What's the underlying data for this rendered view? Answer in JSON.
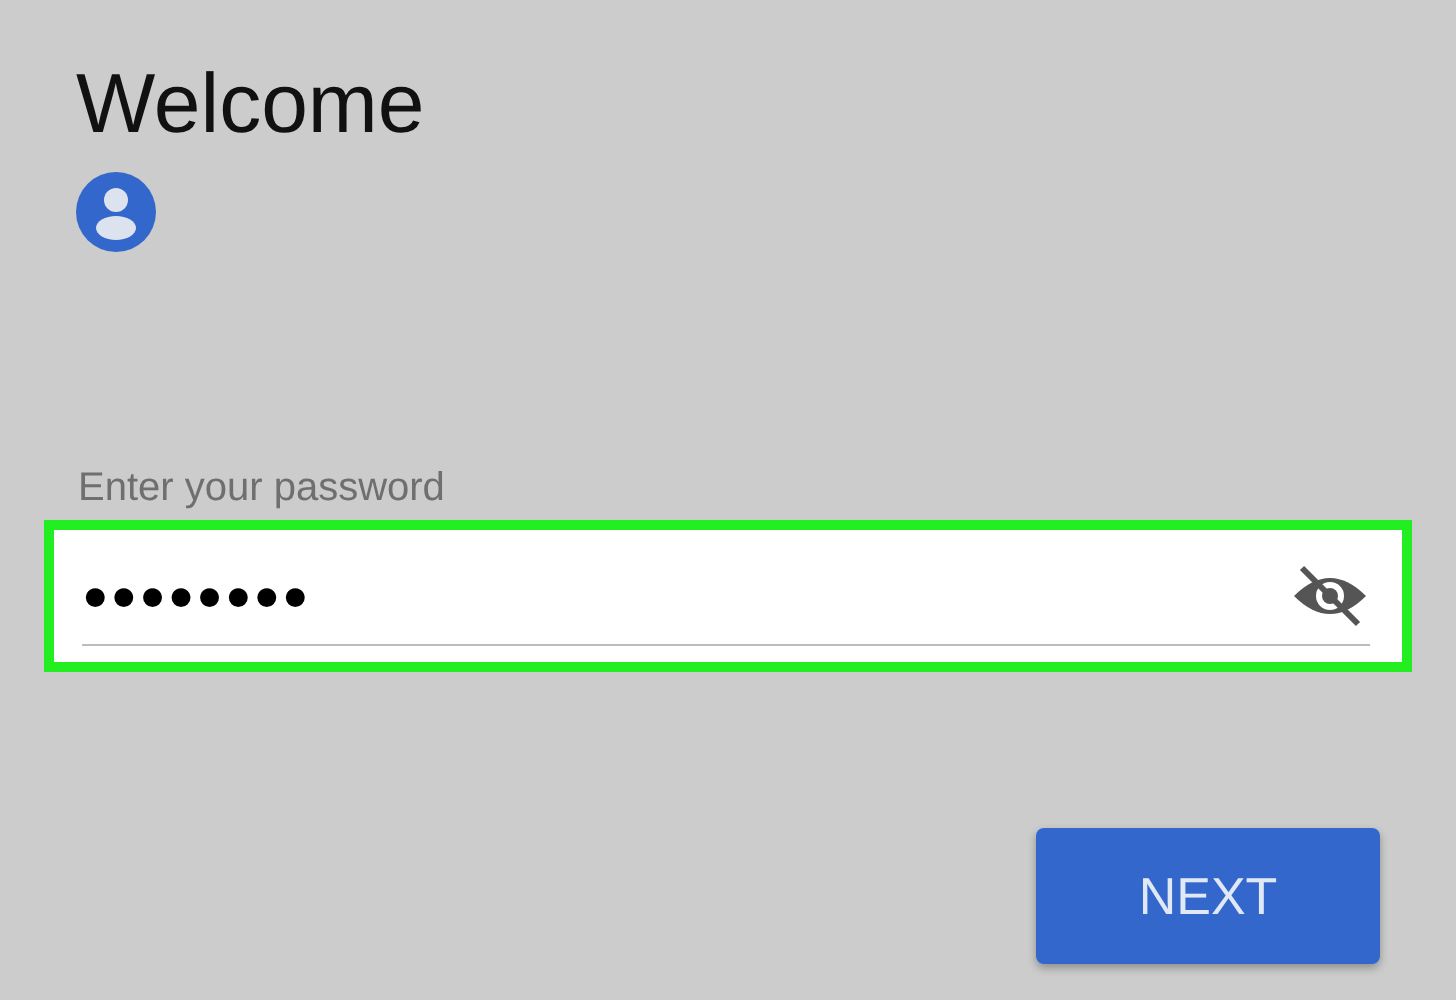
{
  "title": "Welcome",
  "password": {
    "label": "Enter your password",
    "value": "●●●●●●●●",
    "highlighted": true,
    "visible": false
  },
  "next_button": {
    "label": "NEXT"
  }
}
